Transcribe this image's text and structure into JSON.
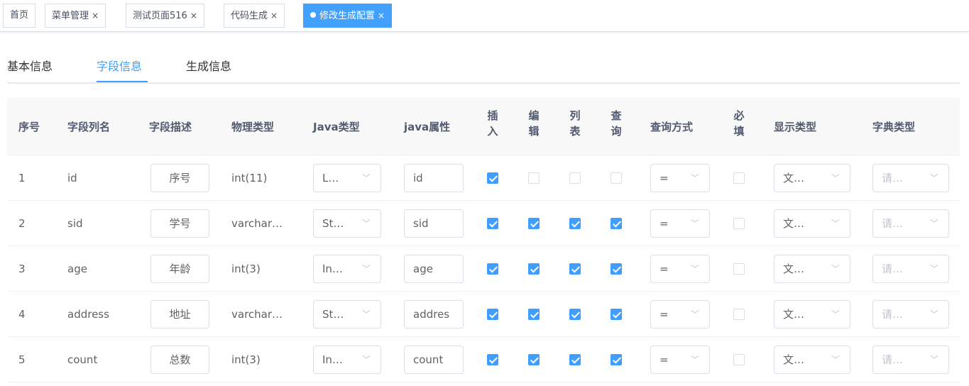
{
  "tags": [
    {
      "label": "首页",
      "closable": false,
      "active": false
    },
    {
      "label": "菜单管理",
      "closable": true,
      "active": false
    },
    {
      "label": "测试页面516",
      "closable": true,
      "active": false
    },
    {
      "label": "代码生成",
      "closable": true,
      "active": false
    },
    {
      "label": "修改生成配置",
      "closable": true,
      "active": true
    }
  ],
  "tab_close_glyph": "×",
  "tabs": [
    "基本信息",
    "字段信息",
    "生成信息"
  ],
  "active_tab": "字段信息",
  "colors": {
    "accent": "#409eff",
    "active_tag": "#42a1ff"
  },
  "table": {
    "headers": {
      "index": "序号",
      "column_name": "字段列名",
      "description": "字段描述",
      "physical_type": "物理类型",
      "java_type": "Java类型",
      "java_field": "java属性",
      "insert": [
        "插",
        "入"
      ],
      "edit": [
        "编",
        "辑"
      ],
      "list": [
        "列",
        "表"
      ],
      "query": [
        "查",
        "询"
      ],
      "query_mode": "查询方式",
      "required": [
        "必",
        "填"
      ],
      "display_type": "显示类型",
      "dict_type": "字典类型"
    },
    "rows": [
      {
        "index": "1",
        "column_name": "id",
        "description": "序号",
        "physical_type": "int(11)",
        "java_type": "L…",
        "java_field": "id",
        "insert": true,
        "edit": false,
        "list": false,
        "query": false,
        "query_mode": "=",
        "required": false,
        "display_type": "文…",
        "dict_type": "请…"
      },
      {
        "index": "2",
        "column_name": "sid",
        "description": "学号",
        "physical_type": "varchar…",
        "java_type": "St…",
        "java_field": "sid",
        "insert": true,
        "edit": true,
        "list": true,
        "query": true,
        "query_mode": "=",
        "required": false,
        "display_type": "文…",
        "dict_type": "请…"
      },
      {
        "index": "3",
        "column_name": "age",
        "description": "年龄",
        "physical_type": "int(3)",
        "java_type": "In…",
        "java_field": "age",
        "insert": true,
        "edit": true,
        "list": true,
        "query": true,
        "query_mode": "=",
        "required": false,
        "display_type": "文…",
        "dict_type": "请…"
      },
      {
        "index": "4",
        "column_name": "address",
        "description": "地址",
        "physical_type": "varchar…",
        "java_type": "St…",
        "java_field": "addres",
        "insert": true,
        "edit": true,
        "list": true,
        "query": true,
        "query_mode": "=",
        "required": false,
        "display_type": "文…",
        "dict_type": "请…"
      },
      {
        "index": "5",
        "column_name": "count",
        "description": "总数",
        "physical_type": "int(3)",
        "java_type": "In…",
        "java_field": "count",
        "insert": true,
        "edit": true,
        "list": true,
        "query": true,
        "query_mode": "=",
        "required": false,
        "display_type": "文…",
        "dict_type": "请…"
      }
    ],
    "select_arrow_icon": "chevron-down-icon"
  }
}
